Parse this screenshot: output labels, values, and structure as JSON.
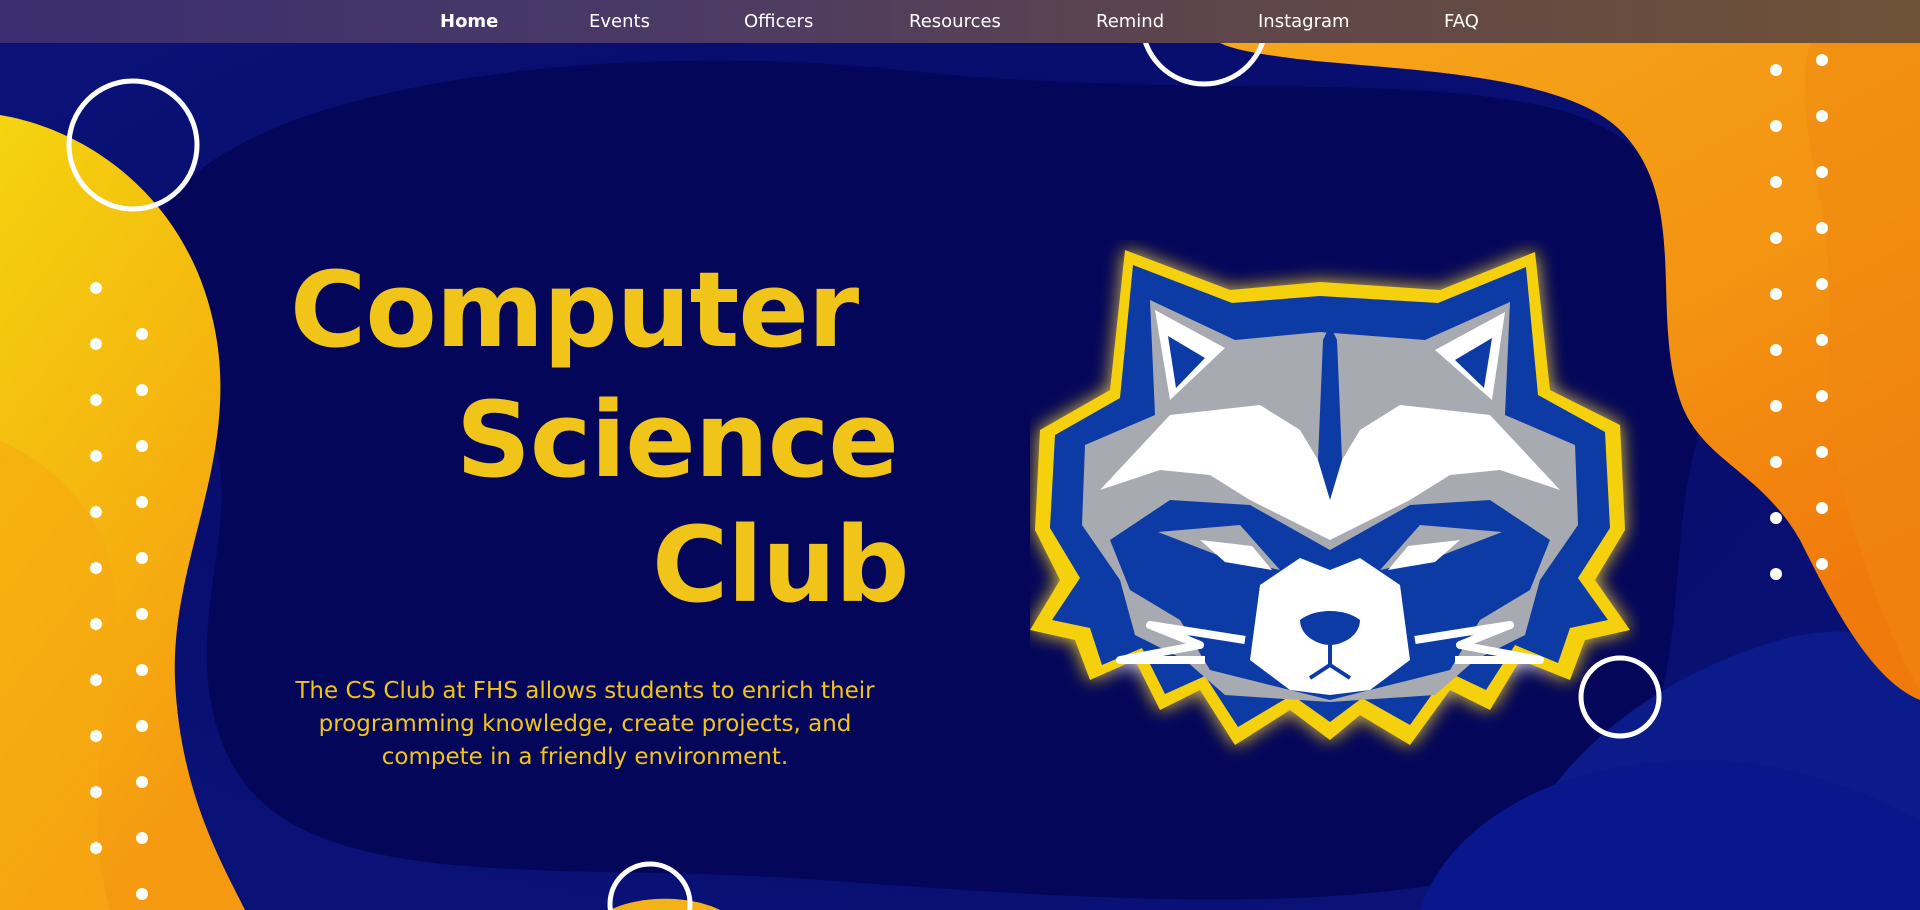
{
  "nav": {
    "items": [
      {
        "label": "Home",
        "active": true
      },
      {
        "label": "Events"
      },
      {
        "label": "Officers"
      },
      {
        "label": "Resources"
      },
      {
        "label": "Remind"
      },
      {
        "label": "Instagram"
      },
      {
        "label": "FAQ"
      }
    ]
  },
  "hero": {
    "title_line1": "Computer",
    "title_line2": "Science",
    "title_line3": "Club",
    "description": "The CS Club at FHS allows students to enrich their programming knowledge, create projects, and compete in a friendly environment.",
    "mascot_icon": "raccoon-mascot"
  },
  "colors": {
    "background": "#02075a",
    "accent_yellow": "#f0c419",
    "accent_orange": "#f7a21a",
    "mascot_blue": "#0a3aa6"
  }
}
